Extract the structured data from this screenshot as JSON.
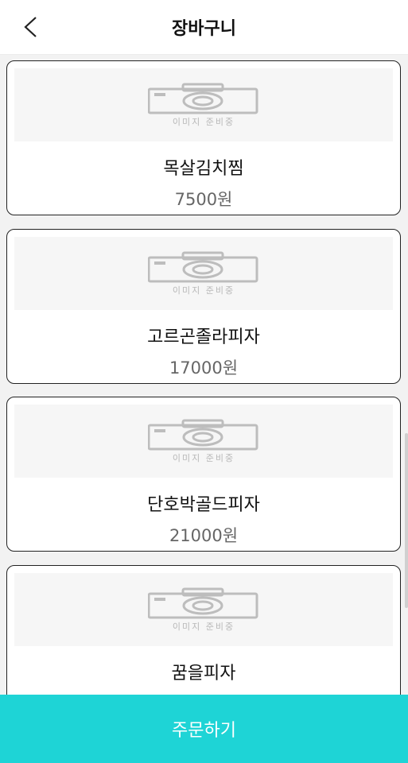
{
  "header": {
    "title": "장바구니",
    "back_icon": "chevron-left-icon"
  },
  "placeholder": {
    "icon": "camera-icon",
    "caption": "이미지 준비중"
  },
  "cart": {
    "items": [
      {
        "name": "목살김치찜",
        "price": "7500원"
      },
      {
        "name": "고르곤졸라피자",
        "price": "17000원"
      },
      {
        "name": "단호박골드피자",
        "price": "21000원"
      },
      {
        "name": "꿈을피자",
        "price": ""
      }
    ]
  },
  "footer": {
    "order_label": "주문하기"
  },
  "colors": {
    "accent": "#1ed4d6",
    "card_border": "#222222",
    "price_text": "#666666"
  }
}
